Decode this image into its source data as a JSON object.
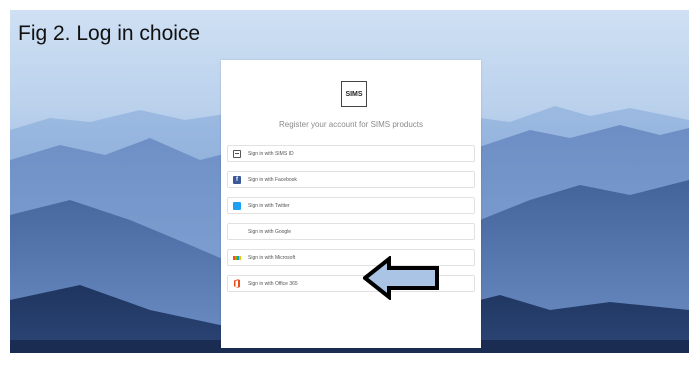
{
  "caption": "Fig 2. Log in choice",
  "card": {
    "logo_text": "SIMS",
    "subtitle": "Register your account for SIMS products",
    "options": [
      {
        "label": "Sign in with SIMS ID",
        "icon": "sims-id-icon"
      },
      {
        "label": "Sign in with Facebook",
        "icon": "facebook-icon"
      },
      {
        "label": "Sign in with Twitter",
        "icon": "twitter-icon"
      },
      {
        "label": "Sign in with Google",
        "icon": "google-icon"
      },
      {
        "label": "Sign in with Microsoft",
        "icon": "microsoft-icon"
      },
      {
        "label": "Sign in with Office 365",
        "icon": "office365-icon"
      }
    ]
  },
  "colors": {
    "facebook": "#3b5998",
    "twitter": "#1da1f2",
    "google": "#db4437",
    "office365": "#e94e1b",
    "arrow_fill": "#a9c4e4",
    "arrow_stroke": "#000000"
  }
}
